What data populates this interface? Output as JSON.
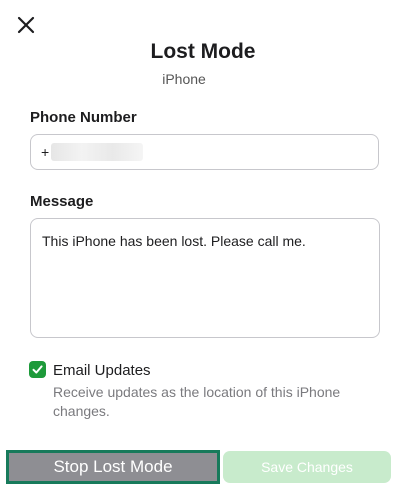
{
  "header": {
    "close_icon": "close-icon",
    "title": "Lost Mode",
    "device_name": "iPhone"
  },
  "phone": {
    "label": "Phone Number",
    "prefix": "+"
  },
  "message": {
    "label": "Message",
    "value": "This iPhone has been lost. Please call me."
  },
  "email_updates": {
    "checked": true,
    "label": "Email Updates",
    "description": "Receive updates as the location of this iPhone changes."
  },
  "actions": {
    "stop_label": "Stop Lost Mode",
    "save_label": "Save Changes"
  },
  "colors": {
    "accent_green": "#1d9a3a",
    "stop_button_bg": "#8e8e93",
    "stop_button_border": "#177a5b",
    "save_button_bg": "#c8ebcc"
  }
}
